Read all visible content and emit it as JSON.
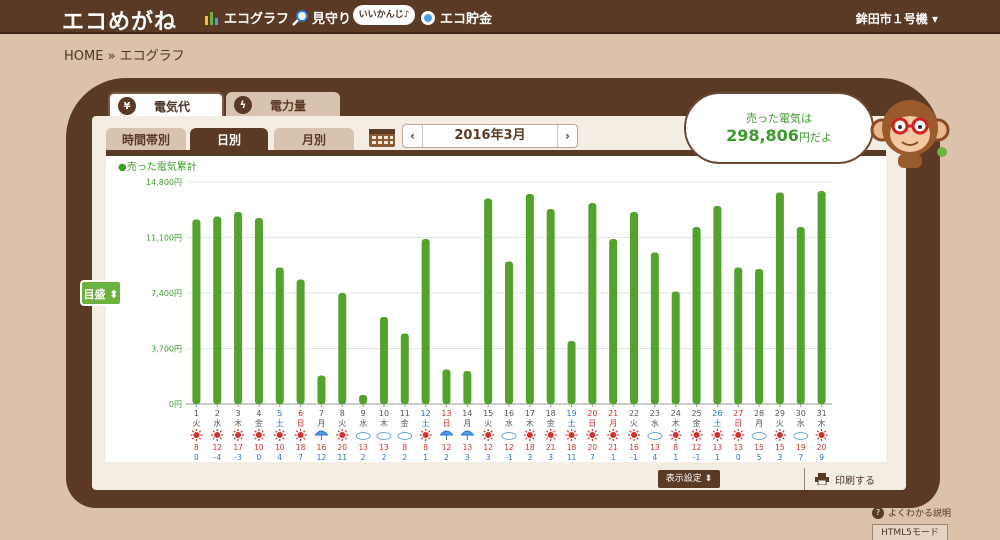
{
  "header": {
    "logo": "エコめがね",
    "nav": [
      {
        "label": "エコグラフ",
        "icon": "bar-chart-icon"
      },
      {
        "label": "見守り",
        "icon": "magnifier-icon"
      },
      {
        "label": "エコ貯金",
        "icon": "coin-icon"
      }
    ],
    "bubble": "いいかんじ♪",
    "user_menu": "鉾田市１号機 ▾"
  },
  "breadcrumb": "HOME » エコグラフ",
  "tabs": {
    "top": [
      {
        "label": "電気代",
        "icon": "yen-icon",
        "active": true
      },
      {
        "label": "電力量",
        "icon": "lightning-icon",
        "active": false
      }
    ],
    "sub": [
      {
        "label": "時間帯別",
        "active": false
      },
      {
        "label": "日別",
        "active": true
      },
      {
        "label": "月別",
        "active": false
      }
    ]
  },
  "month_selector": {
    "prev": "‹",
    "label": "2016年3月",
    "next": "›"
  },
  "summary": {
    "line1": "売った電気は",
    "amount": "298,806",
    "unit": "円だよ"
  },
  "gauge_button": "目盛 ⬍",
  "footer": {
    "settings": "表示設定 ⬍",
    "print": "印刷する",
    "help": "よくわかる説明",
    "html5": "HTML5モード"
  },
  "colors": {
    "brown": "#5b3a25",
    "bar_green": "#53a22b",
    "label_green": "#3c9b2c",
    "saturday_blue": "#2a72d6",
    "sunday_red": "#d33030"
  },
  "chart_data": {
    "type": "bar",
    "series_label": "●売った電気累計",
    "ylim": [
      0,
      14800
    ],
    "yticks": [
      "0円",
      "3,700円",
      "7,400円",
      "11,100円",
      "14,800円"
    ],
    "ytick_values": [
      0,
      3700,
      7400,
      11100,
      14800
    ],
    "days": [
      "1",
      "2",
      "3",
      "4",
      "5",
      "6",
      "7",
      "8",
      "9",
      "10",
      "11",
      "12",
      "13",
      "14",
      "15",
      "16",
      "17",
      "18",
      "19",
      "20",
      "21",
      "22",
      "23",
      "24",
      "25",
      "26",
      "27",
      "28",
      "29",
      "30",
      "31"
    ],
    "weekdays": [
      "火",
      "水",
      "木",
      "金",
      "土",
      "日",
      "月",
      "火",
      "水",
      "木",
      "金",
      "土",
      "日",
      "月",
      "火",
      "水",
      "木",
      "金",
      "土",
      "日",
      "月",
      "火",
      "水",
      "木",
      "金",
      "土",
      "日",
      "月",
      "火",
      "水",
      "木"
    ],
    "day_colors": [
      "n",
      "n",
      "n",
      "n",
      "sat",
      "sun",
      "n",
      "n",
      "n",
      "n",
      "n",
      "sat",
      "sun",
      "n",
      "n",
      "n",
      "n",
      "n",
      "sat",
      "sun",
      "sun",
      "n",
      "n",
      "n",
      "n",
      "sat",
      "sun",
      "n",
      "n",
      "n",
      "n"
    ],
    "values": [
      12300,
      12500,
      12800,
      12400,
      9100,
      8300,
      1900,
      7400,
      600,
      5800,
      4700,
      11000,
      2300,
      2200,
      13700,
      9500,
      14000,
      13000,
      4200,
      13400,
      11000,
      12800,
      10100,
      7500,
      11800,
      13200,
      9100,
      9000,
      14100,
      11800,
      14200
    ],
    "weather": [
      "sun",
      "sun",
      "sun",
      "sun",
      "sun",
      "sun",
      "umbrella",
      "sun",
      "cloud",
      "cloud",
      "cloud",
      "sun",
      "umbrella",
      "umbrella",
      "sun",
      "cloud",
      "sun",
      "sun",
      "sun",
      "sun",
      "sun",
      "sun",
      "cloud",
      "sun",
      "sun",
      "sun",
      "sun",
      "cloud",
      "sun",
      "cloud",
      "sun"
    ],
    "temp_high": [
      "8",
      "12",
      "17",
      "10",
      "10",
      "18",
      "16",
      "20",
      "13",
      "13",
      "8",
      "8",
      "12",
      "13",
      "12",
      "12",
      "18",
      "21",
      "18",
      "20",
      "21",
      "16",
      "13",
      "8",
      "12",
      "13",
      "13",
      "15",
      "15",
      "19",
      "20"
    ],
    "temp_low": [
      "0",
      "-4",
      "-3",
      "0",
      "4",
      "7",
      "12",
      "11",
      "2",
      "2",
      "2",
      "1",
      "2",
      "3",
      "3",
      "-1",
      "3",
      "3",
      "11",
      "7",
      "1",
      "-1",
      "4",
      "1",
      "-1",
      "1",
      "0",
      "5",
      "3",
      "7",
      "9"
    ]
  }
}
